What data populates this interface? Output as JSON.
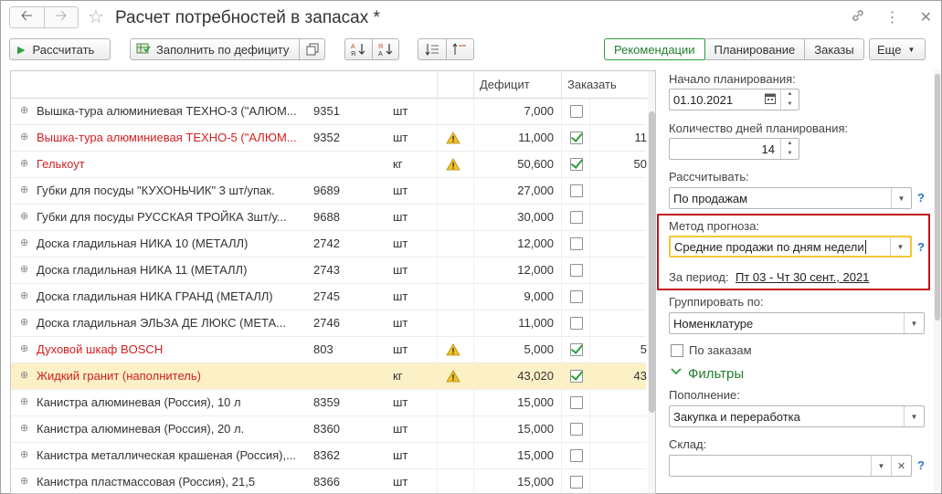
{
  "window": {
    "title": "Расчет потребностей в запасах *"
  },
  "toolbar": {
    "calculate_label": "Рассчитать",
    "fill_deficit_label": "Заполнить по дефициту",
    "more_label": "Еще",
    "tabs": [
      {
        "label": "Рекомендации"
      },
      {
        "label": "Планирование"
      },
      {
        "label": "Заказы"
      }
    ]
  },
  "table": {
    "columns": {
      "deficit": "Дефицит",
      "order": "Заказать"
    },
    "rows": [
      {
        "name": "Вышка-тура алюминиевая ТЕХНО-3 (\"АЛЮМ...",
        "code": "9351",
        "unit": "шт",
        "warn": false,
        "deficit": "7,000",
        "checked": false,
        "extra": "",
        "red": false
      },
      {
        "name": "Вышка-тура алюминиевая ТЕХНО-5 (\"АЛЮМ...",
        "code": "9352",
        "unit": "шт",
        "warn": true,
        "deficit": "11,000",
        "checked": true,
        "extra": "11",
        "red": true
      },
      {
        "name": "Гелькоут",
        "code": "",
        "unit": "кг",
        "warn": true,
        "deficit": "50,600",
        "checked": true,
        "extra": "50",
        "red": true
      },
      {
        "name": "Губки для посуды \"КУХОНЬЧИК\" 3 шт/упак.",
        "code": "9689",
        "unit": "шт",
        "warn": false,
        "deficit": "27,000",
        "checked": false,
        "extra": "",
        "red": false
      },
      {
        "name": "Губки для посуды РУССКАЯ ТРОЙКА 3шт/у...",
        "code": "9688",
        "unit": "шт",
        "warn": false,
        "deficit": "30,000",
        "checked": false,
        "extra": "",
        "red": false
      },
      {
        "name": "Доска гладильная  НИКА 10 (МЕТАЛЛ)",
        "code": "2742",
        "unit": "шт",
        "warn": false,
        "deficit": "12,000",
        "checked": false,
        "extra": "",
        "red": false
      },
      {
        "name": "Доска гладильная  НИКА 11 (МЕТАЛЛ)",
        "code": "2743",
        "unit": "шт",
        "warn": false,
        "deficit": "12,000",
        "checked": false,
        "extra": "",
        "red": false
      },
      {
        "name": "Доска гладильная  НИКА ГРАНД (МЕТАЛЛ)",
        "code": "2745",
        "unit": "шт",
        "warn": false,
        "deficit": "9,000",
        "checked": false,
        "extra": "",
        "red": false
      },
      {
        "name": "Доска гладильная  ЭЛЬЗА ДЕ ЛЮКС (МЕТА...",
        "code": "2746",
        "unit": "шт",
        "warn": false,
        "deficit": "11,000",
        "checked": false,
        "extra": "",
        "red": false
      },
      {
        "name": "Духовой шкаф                    BOSCH",
        "code": "803",
        "unit": "шт",
        "warn": true,
        "deficit": "5,000",
        "checked": true,
        "extra": "5",
        "red": true
      },
      {
        "name": "Жидкий гранит (наполнитель)",
        "code": "",
        "unit": "кг",
        "warn": true,
        "deficit": "43,020",
        "checked": true,
        "extra": "43",
        "red": true,
        "selected": true
      },
      {
        "name": "Канистра алюминевая (Россия), 10 л",
        "code": "8359",
        "unit": "шт",
        "warn": false,
        "deficit": "15,000",
        "checked": false,
        "extra": "",
        "red": false
      },
      {
        "name": "Канистра алюминевая (Россия), 20 л.",
        "code": "8360",
        "unit": "шт",
        "warn": false,
        "deficit": "15,000",
        "checked": false,
        "extra": "",
        "red": false
      },
      {
        "name": "Канистра металлическая крашеная (Россия),...",
        "code": "8362",
        "unit": "шт",
        "warn": false,
        "deficit": "15,000",
        "checked": false,
        "extra": "",
        "red": false
      },
      {
        "name": "Канистра пластмассовая (Россия), 21,5",
        "code": "8366",
        "unit": "шт",
        "warn": false,
        "deficit": "15,000",
        "checked": false,
        "extra": "",
        "red": false
      }
    ]
  },
  "panel": {
    "start_label": "Начало планирования:",
    "start_value": "01.10.2021",
    "days_label": "Количество дней планирования:",
    "days_value": "14",
    "calc_label": "Рассчитывать:",
    "calc_value": "По продажам",
    "method_label": "Метод прогноза:",
    "method_value": "Средние продажи по дням недели",
    "period_label": "За период:",
    "period_value": "Пт 03 - Чт 30 сент., 2021",
    "group_label": "Группировать по:",
    "group_value": "Номенклатуре",
    "by_orders_label": "По заказам",
    "filters_label": "Фильтры",
    "replenish_label": "Пополнение:",
    "replenish_value": "Закупка и переработка",
    "warehouse_label": "Склад:",
    "warehouse_value": "",
    "help": "?"
  },
  "colors": {
    "accent_green": "#2e9f3a",
    "error_red": "#d21f1f",
    "highlight_box": "#c4121a",
    "selected_row": "#fbf0c6"
  }
}
